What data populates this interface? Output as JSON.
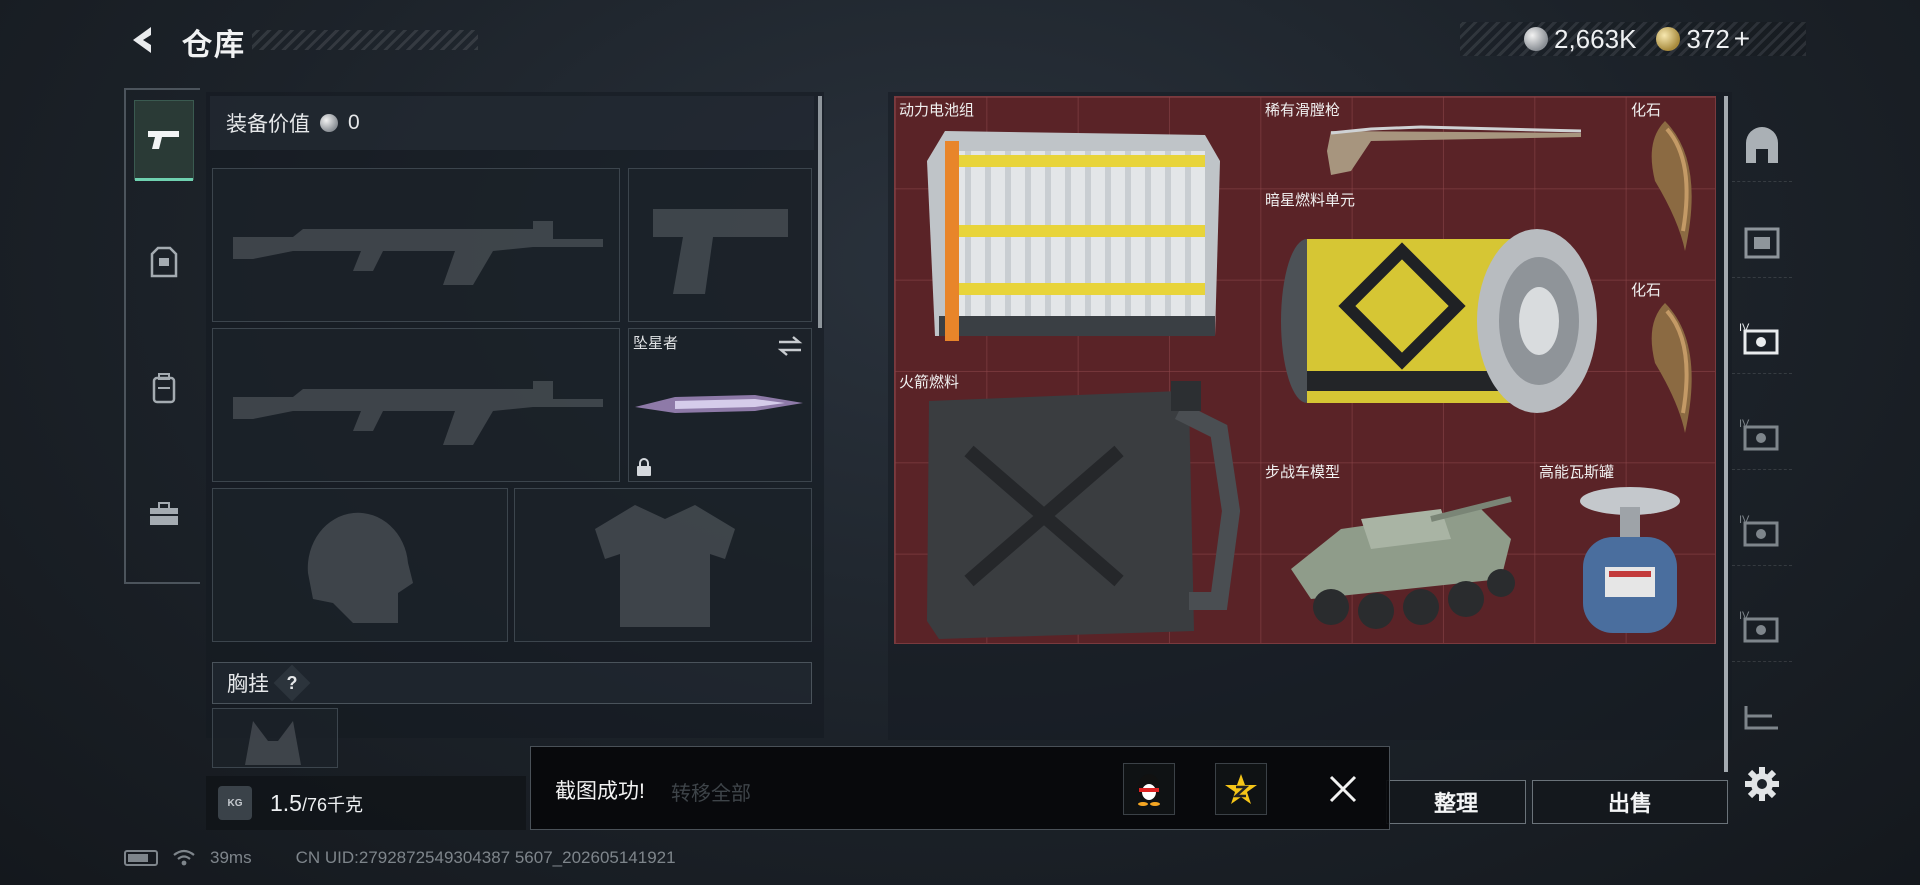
{
  "header": {
    "title": "仓库",
    "silver_amount": "2,663K",
    "gold_amount": "372",
    "add_label": "+"
  },
  "left_nav": {
    "items": [
      {
        "name": "weapons",
        "icon": "pistol-icon",
        "active": true
      },
      {
        "name": "armor",
        "icon": "armor-vest-icon",
        "active": false
      },
      {
        "name": "backpack",
        "icon": "backpack-icon",
        "active": false
      },
      {
        "name": "toolkit",
        "icon": "toolbox-icon",
        "active": false
      }
    ]
  },
  "equipment": {
    "value_label": "装备价值",
    "value_amount": "0",
    "melee_slot_label": "坠星者",
    "chest_rig_label": "胸挂",
    "chest_rig_help": "?"
  },
  "weight": {
    "icon_text": "KG",
    "current": "1.5",
    "max": "/76千克"
  },
  "storage": {
    "items": [
      {
        "name": "动力电池组",
        "key": "battery-pack"
      },
      {
        "name": "稀有滑膛枪",
        "key": "rare-musket"
      },
      {
        "name": "化石",
        "key": "fossil-1"
      },
      {
        "name": "暗星燃料单元",
        "key": "dark-star-fuel-cell"
      },
      {
        "name": "化石",
        "key": "fossil-2"
      },
      {
        "name": "火箭燃料",
        "key": "rocket-fuel"
      },
      {
        "name": "步战车模型",
        "key": "ifv-model"
      },
      {
        "name": "高能瓦斯罐",
        "key": "gas-canister"
      }
    ],
    "grid_color": "#5a2327"
  },
  "right_tabs": [
    "home-tab-icon",
    "case-tab-icon",
    "case-iv-tab-icon",
    "case-iv-tab-icon",
    "case-iv-tab-icon",
    "case-iv-tab-icon",
    "shelf-tab-icon"
  ],
  "buttons": {
    "transfer_all": "转移全部",
    "organize": "整理",
    "sell": "出售"
  },
  "toast": {
    "message": "截图成功!",
    "qq_icon": "qq-penguin-icon",
    "qzone_icon": "qzone-star-icon"
  },
  "status_bar": {
    "ping": "39ms",
    "uid": "CN UID:2792872549304387 5607_202605141921"
  },
  "colors": {
    "accent": "#6fd1b0",
    "grid_red": "#5a2327",
    "panel": "#1c2229"
  }
}
